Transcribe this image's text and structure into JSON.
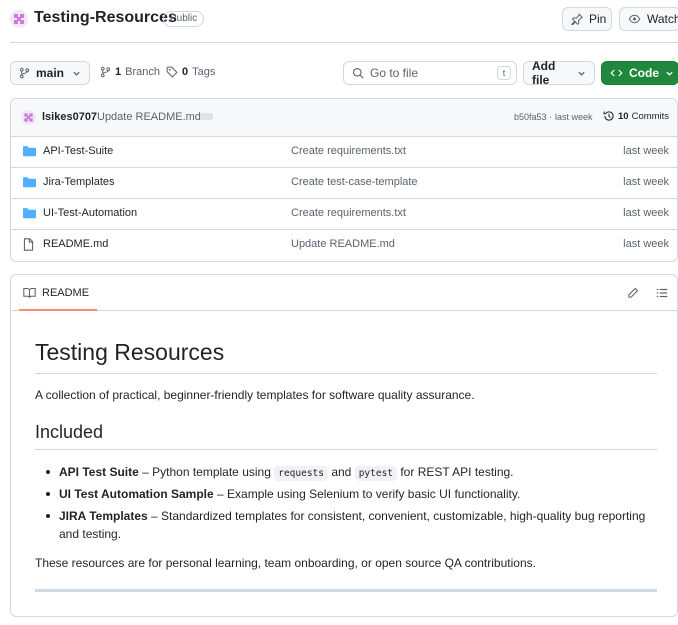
{
  "repo": {
    "name": "Testing-Resources",
    "visibility": "Public",
    "pin_label": "Pin",
    "watch_label": "Watch"
  },
  "toolbar": {
    "branch": "main",
    "branch_count": "1",
    "branch_label": "Branch",
    "tag_count": "0",
    "tag_label": "Tags",
    "goto_placeholder": "Go to file",
    "goto_shortcut": "t",
    "addfile_label": "Add file",
    "code_label": "Code"
  },
  "commit": {
    "author": "lsikes0707",
    "message": "Update README.md",
    "hash": "b50fa53",
    "sep": "·",
    "when": "last week",
    "commit_count": "10",
    "commit_label": "Commits"
  },
  "files": [
    {
      "name": "API-Test-Suite",
      "type": "folder",
      "message": "Create requirements.txt",
      "date": "last week"
    },
    {
      "name": "Jira-Templates",
      "type": "folder",
      "message": "Create test-case-template",
      "date": "last week"
    },
    {
      "name": "UI-Test-Automation",
      "type": "folder",
      "message": "Create requirements.txt",
      "date": "last week"
    },
    {
      "name": "README.md",
      "type": "file",
      "message": "Update README.md",
      "date": "last week"
    }
  ],
  "readme": {
    "tab_label": "README",
    "h1": "Testing Resources",
    "intro": "A collection of practical, beginner-friendly templates for software quality assurance.",
    "h2": "Included",
    "items": [
      {
        "title": "API Test Suite",
        "dash": " – ",
        "text_a": "Python template using ",
        "code_a": "requests",
        "text_b": " and ",
        "code_b": "pytest",
        "text_c": " for REST API testing."
      },
      {
        "title": "UI Test Automation Sample",
        "dash": " – ",
        "text": "Example using Selenium to verify basic UI functionality."
      },
      {
        "title": "JIRA Templates",
        "dash": " – ",
        "text": "Standardized templates for consistent, convenient, customizable, high-quality bug reporting and testing."
      }
    ],
    "outro": "These resources are for personal learning, team onboarding, or open source QA contributions."
  },
  "colors": {
    "accent_green": "#1f883d",
    "folder_blue": "#54aeff",
    "tab_underline": "#fd8c73"
  }
}
